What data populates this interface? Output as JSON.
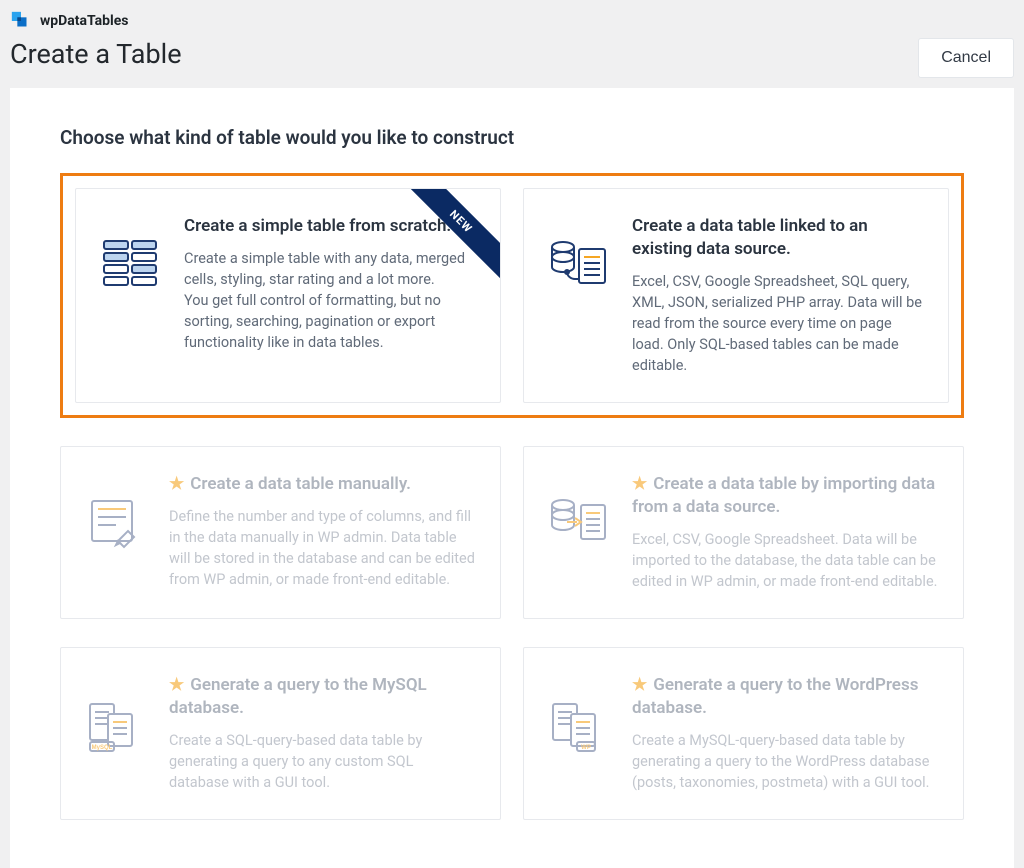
{
  "brand": {
    "name": "wpDataTables"
  },
  "page": {
    "title": "Create a Table"
  },
  "actions": {
    "cancel": "Cancel"
  },
  "panel": {
    "heading": "Choose what kind of table would you like to construct",
    "ribbon_new": "NEW"
  },
  "cards": {
    "simple": {
      "title": "Create a simple table from scratch.",
      "desc": "Create a simple table with any data, merged cells, styling, star rating and a lot more.\nYou get full control of formatting, but no sorting, searching, pagination or export functionality like in data tables."
    },
    "linked": {
      "title": "Create a data table linked to an existing data source.",
      "desc": "Excel, CSV, Google Spreadsheet, SQL query, XML, JSON, serialized PHP array. Data will be read from the source every time on page load. Only SQL-based tables can be made editable."
    },
    "manual": {
      "title": "Create a data table manually.",
      "desc": "Define the number and type of columns, and fill in the data manually in WP admin. Data table will be stored in the database and can be edited from WP admin, or made front-end editable."
    },
    "import": {
      "title": "Create a data table by importing data from a data source.",
      "desc": "Excel, CSV, Google Spreadsheet. Data will be imported to the database, the data table can be edited in WP admin, or made front-end editable."
    },
    "mysql": {
      "title": "Generate a query to the MySQL database.",
      "desc": "Create a SQL-query-based data table by generating a query to any custom SQL database with a GUI tool."
    },
    "wp": {
      "title": "Generate a query to the WordPress database.",
      "desc": "Create a MySQL-query-based data table by generating a query to the WordPress database (posts, taxonomies, postmeta) with a GUI tool."
    }
  }
}
